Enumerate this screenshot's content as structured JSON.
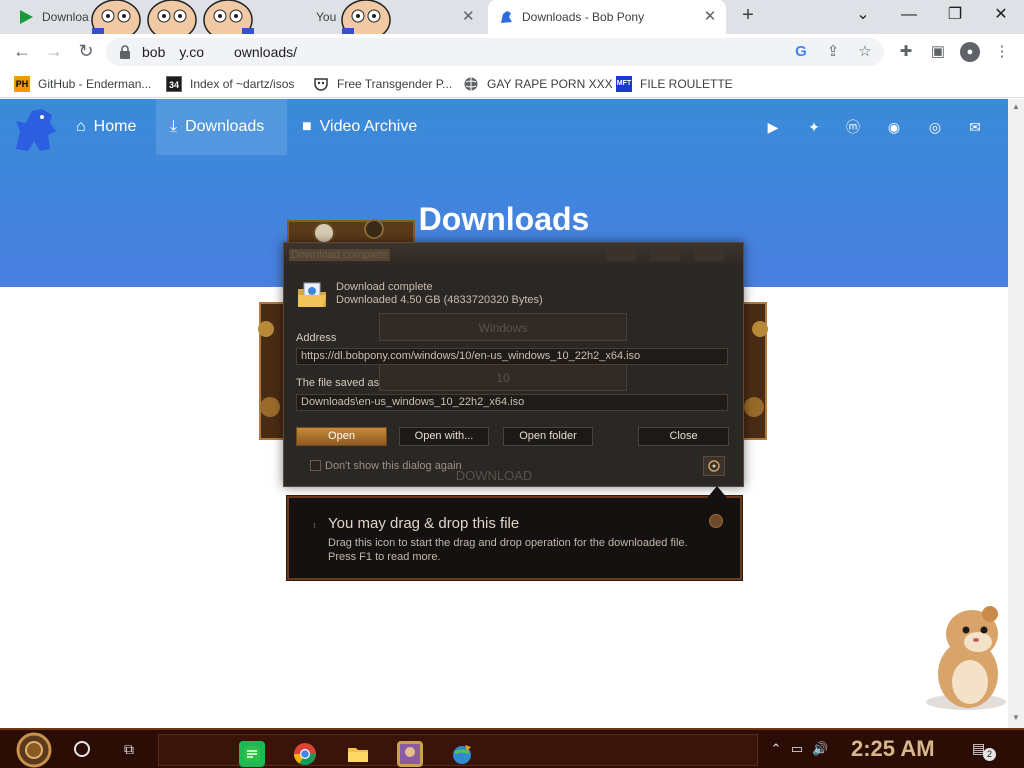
{
  "browser": {
    "tabs": [
      {
        "title": "Downloa",
        "active": false
      },
      {
        "title": "You",
        "active": false
      },
      {
        "title": "Downloads - Bob Pony",
        "active": true
      }
    ],
    "new_tab_symbol": "+",
    "window_controls": {
      "list": "⌄",
      "minimize": "—",
      "maximize": "❐",
      "close": "✕"
    },
    "address": "bobpony.com/downloads/",
    "address_fragments": {
      "left": "bob",
      "mid": "y.co",
      "right": "ownloads/"
    },
    "bookmarks": [
      {
        "label": "GitHub - Enderman...",
        "icon": "PH"
      },
      {
        "label": "Index of ~dartz/isos",
        "icon": "34"
      },
      {
        "label": "Free Transgender P...",
        "icon": "mask"
      },
      {
        "label": "GAY RAPE PORN XXX",
        "icon": "globe"
      },
      {
        "label": "FILE ROULETTE",
        "icon": "MFT"
      }
    ]
  },
  "site": {
    "nav": [
      {
        "label": "Home",
        "icon": "home-icon"
      },
      {
        "label": "Downloads",
        "icon": "download-icon"
      },
      {
        "label": "Video Archive",
        "icon": "video-icon"
      }
    ],
    "social_icons": [
      "youtube-icon",
      "twitter-icon",
      "mastodon-icon",
      "discord-icon",
      "github-icon",
      "mail-icon"
    ],
    "hero_title": "Downloads",
    "ghost_fields": {
      "os": "Windows",
      "version": "10",
      "download": "DOWNLOAD"
    }
  },
  "dialog": {
    "title": "Download complete",
    "status_line1": "Download complete",
    "status_line2": "Downloaded  4.50  GB (4833720320 Bytes)",
    "address_label": "Address",
    "address_value": "https://dl.bobpony.com/windows/10/en-us_windows_10_22h2_x64.iso",
    "saved_label": "The file saved as",
    "saved_value": "Downloads\\en-us_windows_10_22h2_x64.iso",
    "buttons": {
      "open": "Open",
      "open_with": "Open with...",
      "open_folder": "Open folder",
      "close": "Close"
    },
    "checkbox_label": "Don't show this dialog again"
  },
  "tooltip": {
    "title": "You may drag & drop this file",
    "line1": "Drag this icon to start the drag and drop operation for the downloaded file.",
    "line2": "Press F1 to read more."
  },
  "taskbar": {
    "clock": "2:25 AM",
    "notification_count": "2"
  },
  "colors": {
    "hero_blue": "#3f87dc",
    "dialog_bg": "#2b2724",
    "taskbar_bg": "#2b0d06",
    "open_button": "#c68a3a"
  }
}
